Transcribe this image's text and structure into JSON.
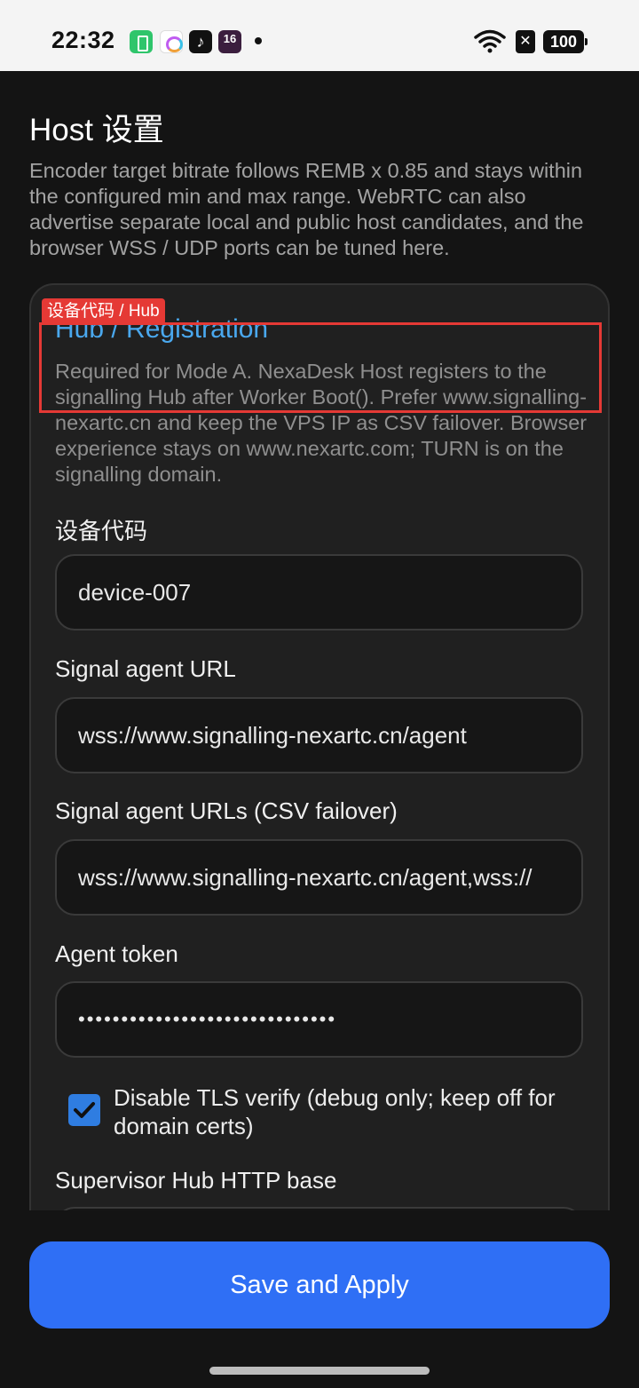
{
  "status_bar": {
    "time": "22:32",
    "tiktok_glyph": "♪",
    "calendar_day": "16",
    "sim_glyph": "✕",
    "battery": "100"
  },
  "page": {
    "title": "Host 设置",
    "description": "Encoder target bitrate follows REMB x 0.85 and stays within the configured min and max range. WebRTC can also advertise separate local and public host candidates, and the browser WSS / UDP ports can be tuned here."
  },
  "annotation": {
    "tag": "设备代码 / Hub",
    "color": "#e53935"
  },
  "section": {
    "title": "Hub / Registration",
    "description": "Required for Mode A. NexaDesk Host registers to the signalling Hub after Worker Boot(). Prefer www.signalling-nexartc.cn and keep the VPS IP as CSV failover. Browser experience stays on www.nexartc.com; TURN is on the signalling domain."
  },
  "fields": {
    "device_code": {
      "label": "设备代码",
      "value": "device-007"
    },
    "signal_agent_url": {
      "label": "Signal agent URL",
      "value": "wss://www.signalling-nexartc.cn/agent"
    },
    "signal_agent_urls": {
      "label": "Signal agent URLs (CSV failover)",
      "value": "wss://www.signalling-nexartc.cn/agent,wss://"
    },
    "agent_token": {
      "label": "Agent token",
      "value": "••••••••••••••••••••••••••••••"
    },
    "disable_tls": {
      "label": "Disable TLS verify (debug only; keep off for domain certs)",
      "checked": true
    },
    "supervisor_hub": {
      "label": "Supervisor Hub HTTP base"
    }
  },
  "actions": {
    "save_label": "Save and Apply"
  },
  "colors": {
    "accent": "#2f6ff5",
    "section_title": "#4aa8ee",
    "background": "#141414"
  }
}
